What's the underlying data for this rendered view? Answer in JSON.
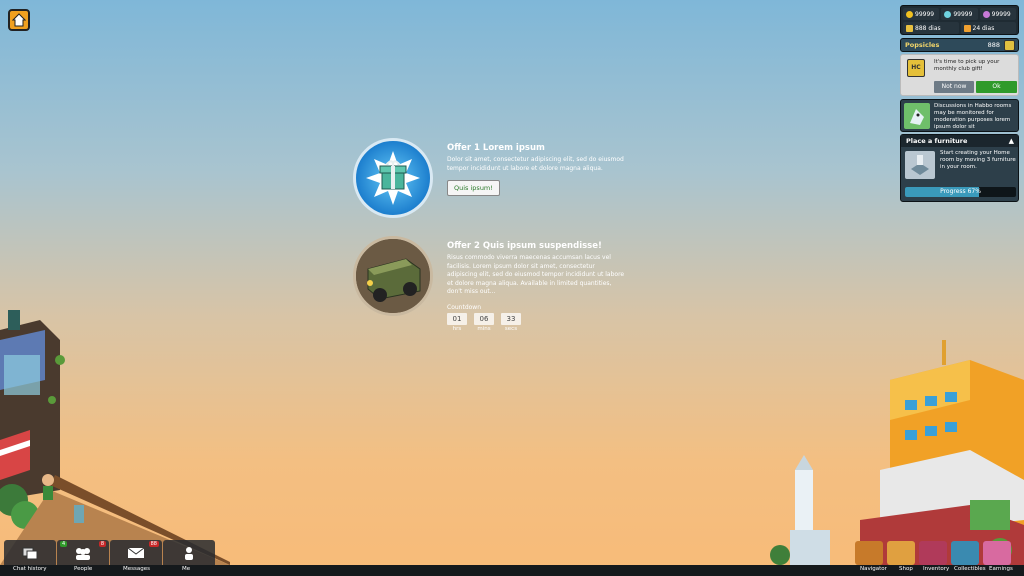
{
  "wallet": {
    "credits": "99999",
    "diamonds": "99999",
    "duckets": "99999",
    "hc_days": "888 dias",
    "builder_days": "24 dias"
  },
  "popsicles": {
    "label": "Popsicles",
    "count": "888"
  },
  "club_gift": {
    "icon_label": "HC",
    "message": "It's time to pick up your monthly club gift!",
    "not_now": "Not now",
    "ok": "Ok"
  },
  "moderation": {
    "message": "Discussions in Habbo rooms may be monitored for moderation purposes lorem ipsum dolor sit"
  },
  "place_furniture": {
    "title": "Place a furniture",
    "message": "Start creating your Home room by moving 3 furniture in your room.",
    "progress_label": "Progress",
    "progress_value": "67%",
    "progress_fraction": 0.67
  },
  "offers": [
    {
      "title": "Offer 1 Lorem ipsum",
      "description": "Dolor sit amet, consectetur adipiscing elit, sed do eiusmod tempor incididunt ut labore et dolore magna aliqua.",
      "button": "Quis ipsum!"
    },
    {
      "title": "Offer 2 Quis ipsum suspendisse!",
      "description": "Risus commodo viverra maecenas accumsan lacus vel facilisis. Lorem ipsum dolor sit amet, consectetur adipiscing elit, sed do eiusmod tempor incididunt ut labore et dolore magna aliqua. Available in limited quantities, don't miss out...",
      "countdown_label": "Countdown",
      "countdown": [
        {
          "value": "01",
          "unit": "hrs"
        },
        {
          "value": "06",
          "unit": "mins"
        },
        {
          "value": "33",
          "unit": "secs"
        }
      ]
    }
  ],
  "bottom_left": {
    "chat_history": "Chat history",
    "people": "People",
    "people_badge_green": "4",
    "people_badge_red": "8",
    "messages": "Messages",
    "messages_badge": "88",
    "me": "Me"
  },
  "bottom_right": {
    "navigator": "Navigator",
    "shop": "Shop",
    "inventory": "Inventory",
    "collectibles": "Collectibles",
    "earnings": "Earnings"
  },
  "colors": {
    "sky_top": "#7fb7d8",
    "sky_bottom": "#f8bb78",
    "panel_bg": "#1f2b33",
    "ok_green": "#2f9a2a",
    "popsicles_text": "#f3d66a"
  },
  "icons": [
    "home-icon",
    "coin-icon",
    "diamond-icon",
    "ducket-icon",
    "hc-icon",
    "builder-icon",
    "popsicle-icon",
    "gift-icon",
    "shark-icon",
    "chevron-up-icon",
    "chat-history-icon",
    "people-icon",
    "messages-icon",
    "me-icon",
    "navigator-icon",
    "shop-icon",
    "inventory-icon",
    "collectibles-icon",
    "earnings-icon"
  ]
}
